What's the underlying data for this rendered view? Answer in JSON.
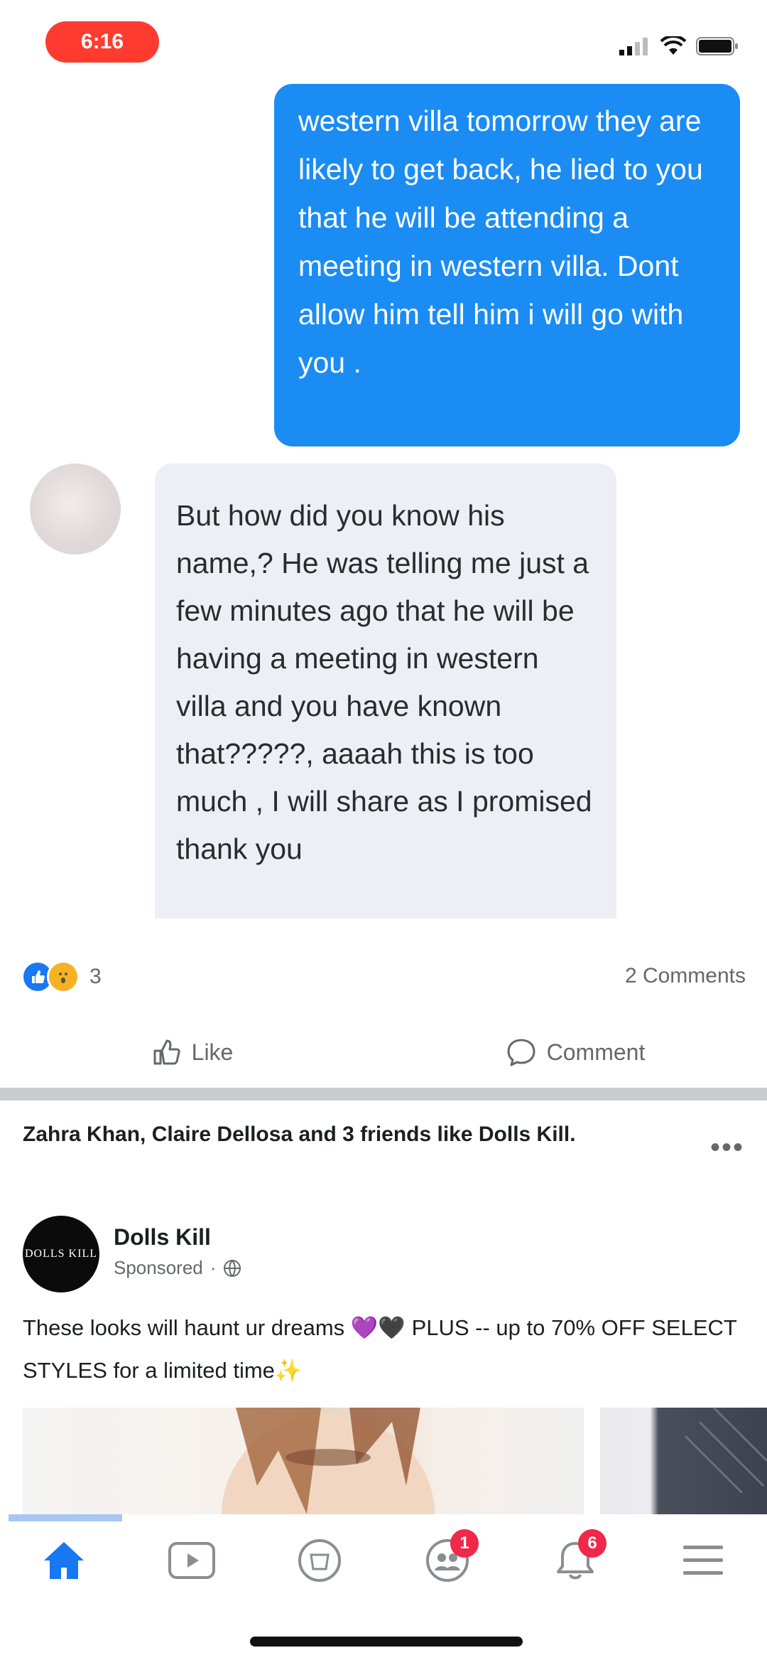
{
  "status_bar": {
    "time": "6:16"
  },
  "chat": {
    "outgoing_message": "western villa tomorrow they are likely to get back, he lied to you that he will be attending a meeting in western villa. Dont allow him tell him i will go with you .",
    "incoming_message": "But how did you know his name,? He was telling me just a few minutes ago that he will be having a meeting in western villa and you have known that?????, aaaah this is too much , I will share as I promised thank you"
  },
  "post_footer": {
    "reaction_count": "3",
    "comments_count": "2 Comments",
    "like_label": "Like",
    "comment_label": "Comment"
  },
  "ad_post": {
    "social_context": "Zahra Khan, Claire Dellosa and 3 friends like Dolls Kill.",
    "page_name": "Dolls Kill",
    "sponsored_label": "Sponsored",
    "avatar_text": "DOLLS KILL",
    "text": "These looks will haunt ur dreams 💜🖤 PLUS -- up to 70% OFF SELECT STYLES for a limited time✨"
  },
  "tabbar": {
    "items": [
      {
        "name": "home",
        "active": true
      },
      {
        "name": "watch"
      },
      {
        "name": "marketplace"
      },
      {
        "name": "groups",
        "badge": "1"
      },
      {
        "name": "notifications",
        "badge": "6"
      },
      {
        "name": "menu"
      }
    ]
  },
  "colors": {
    "brand_blue": "#1877f2",
    "outgoing_bubble": "#1a8cf4",
    "incoming_bubble": "#eeeef7",
    "badge_red": "#f02849",
    "time_pill": "#ff3b30"
  }
}
